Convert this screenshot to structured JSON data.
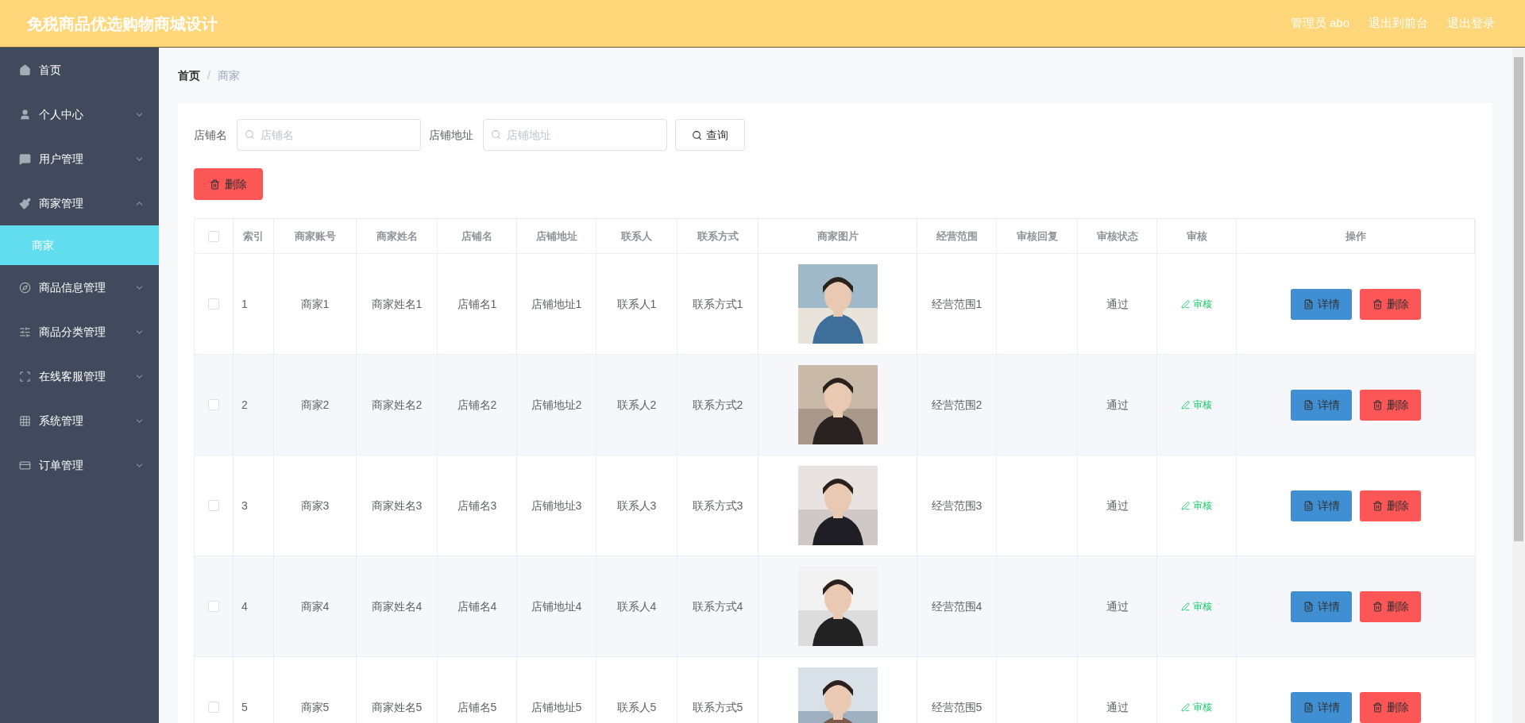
{
  "header": {
    "title": "免税商品优选购物商城设计",
    "links": [
      "管理员 abo",
      "退出到前台",
      "退出登录"
    ]
  },
  "sidebar": {
    "items": [
      {
        "label": "首页",
        "kind": "link"
      },
      {
        "label": "个人中心",
        "kind": "menu",
        "expanded": false
      },
      {
        "label": "用户管理",
        "kind": "menu",
        "expanded": false
      },
      {
        "label": "商家管理",
        "kind": "menu",
        "expanded": true,
        "children": [
          {
            "label": "商家",
            "selected": true
          }
        ]
      },
      {
        "label": "商品信息管理",
        "kind": "menu",
        "expanded": false
      },
      {
        "label": "商品分类管理",
        "kind": "menu",
        "expanded": false
      },
      {
        "label": "在线客服管理",
        "kind": "menu",
        "expanded": false
      },
      {
        "label": "系统管理",
        "kind": "menu",
        "expanded": false
      },
      {
        "label": "订单管理",
        "kind": "menu",
        "expanded": false
      }
    ]
  },
  "breadcrumb": {
    "items": [
      "首页",
      "商家"
    ],
    "separator": "/"
  },
  "search": {
    "fields": [
      {
        "label": "店铺名",
        "placeholder": "店铺名"
      },
      {
        "label": "店铺地址",
        "placeholder": "店铺地址"
      }
    ],
    "button": "查询"
  },
  "bulk_delete": "删除",
  "table": {
    "select_all": {
      "checked": false
    },
    "columns": [
      "索引",
      "商家账号",
      "商家姓名",
      "店铺名",
      "店铺地址",
      "联系人",
      "联系方式",
      "商家图片",
      "经营范围",
      "审核回复",
      "审核状态",
      "审核",
      "操作"
    ],
    "rows": [
      {
        "checked": false,
        "cells": [
          "1",
          "商家1",
          "商家姓名1",
          "店铺名1",
          "店铺地址1",
          "联系人1",
          "联系方式1"
        ],
        "photo": {
          "kind": "picture"
        },
        "scope": "经营范围1",
        "status": "通过",
        "review": "审核",
        "actions": [
          "详情",
          "删除"
        ]
      },
      {
        "checked": false,
        "cells": [
          "2",
          "商家2",
          "商家姓名2",
          "店铺名2",
          "店铺地址2",
          "联系人2",
          "联系方式2"
        ],
        "photo": {
          "kind": "picture"
        },
        "scope": "经营范围2",
        "status": "通过",
        "review": "审核",
        "actions": [
          "详情",
          "删除"
        ]
      },
      {
        "checked": false,
        "cells": [
          "3",
          "商家3",
          "商家姓名3",
          "店铺名3",
          "店铺地址3",
          "联系人3",
          "联系方式3"
        ],
        "photo": {
          "kind": "picture"
        },
        "scope": "经营范围3",
        "status": "通过",
        "review": "审核",
        "actions": [
          "详情",
          "删除"
        ]
      },
      {
        "checked": false,
        "cells": [
          "4",
          "商家4",
          "商家姓名4",
          "店铺名4",
          "店铺地址4",
          "联系人4",
          "联系方式4"
        ],
        "photo": {
          "kind": "picture"
        },
        "scope": "经营范围4",
        "status": "通过",
        "review": "审核",
        "actions": [
          "详情",
          "删除"
        ]
      },
      {
        "checked": false,
        "cells": [
          "5",
          "商家5",
          "商家姓名5",
          "店铺名5",
          "店铺地址5",
          "联系人5",
          "联系方式5"
        ],
        "photo": {
          "kind": "picture"
        },
        "scope": "经营范围5",
        "status": "通过",
        "review": "审核",
        "actions": [
          "详情",
          "删除"
        ]
      }
    ]
  }
}
